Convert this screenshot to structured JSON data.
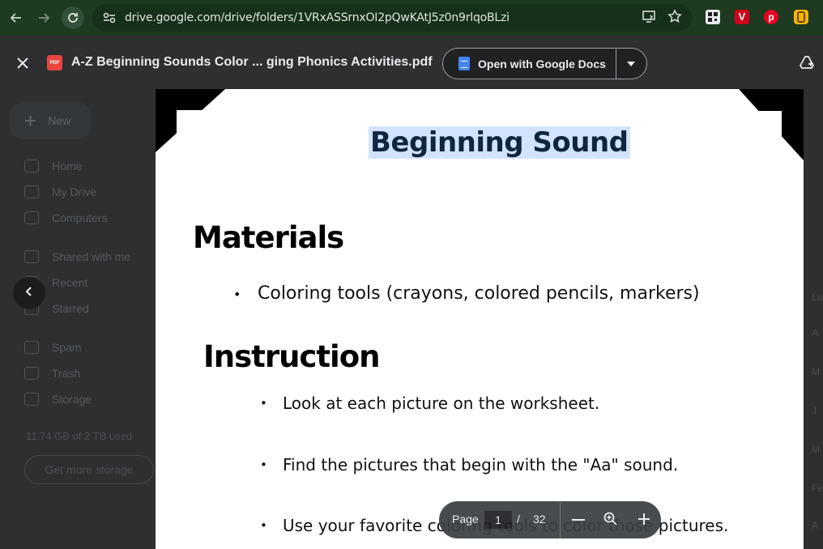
{
  "browser": {
    "url": "drive.google.com/drive/folders/1VRxASSrnxOI2pQwKAtJ5z0n9rlqoBLzi",
    "colors": {
      "chrome_bg": "#1e3a21",
      "omnibox_bg": "#16301a"
    }
  },
  "drive": {
    "new_label": "New",
    "nav": [
      "Home",
      "My Drive",
      "Computers",
      "Shared with me",
      "Recent",
      "Starred",
      "Spam",
      "Trash",
      "Storage"
    ],
    "storage_text": "11.74 GB of 2 TB used",
    "storage_button": "Get more storage",
    "right_letters": [
      "La",
      "A",
      "M",
      "J",
      "M",
      "Fe",
      "A"
    ]
  },
  "viewer": {
    "file_title": "A-Z Beginning Sounds Color ... ging Phonics Activities.pdf",
    "pdf_badge": "PDF",
    "open_with_label": "Open with Google Docs"
  },
  "document": {
    "title": "Beginning Sound",
    "materials_heading": "Materials",
    "materials_items": [
      "Coloring tools (crayons, colored pencils, markers)"
    ],
    "instruction_heading": "Instruction",
    "instruction_items": [
      "Look at each picture on the worksheet.",
      "Find the pictures that begin with the \"Aa\" sound.",
      "Use your favorite coloring tools to color those pictures."
    ],
    "bullet": "•",
    "colors": {
      "title_highlight": "#d3e3fd",
      "title_text": "#10253f"
    }
  },
  "page_controls": {
    "label": "Page",
    "current": "1",
    "separator": "/",
    "total": "32"
  }
}
